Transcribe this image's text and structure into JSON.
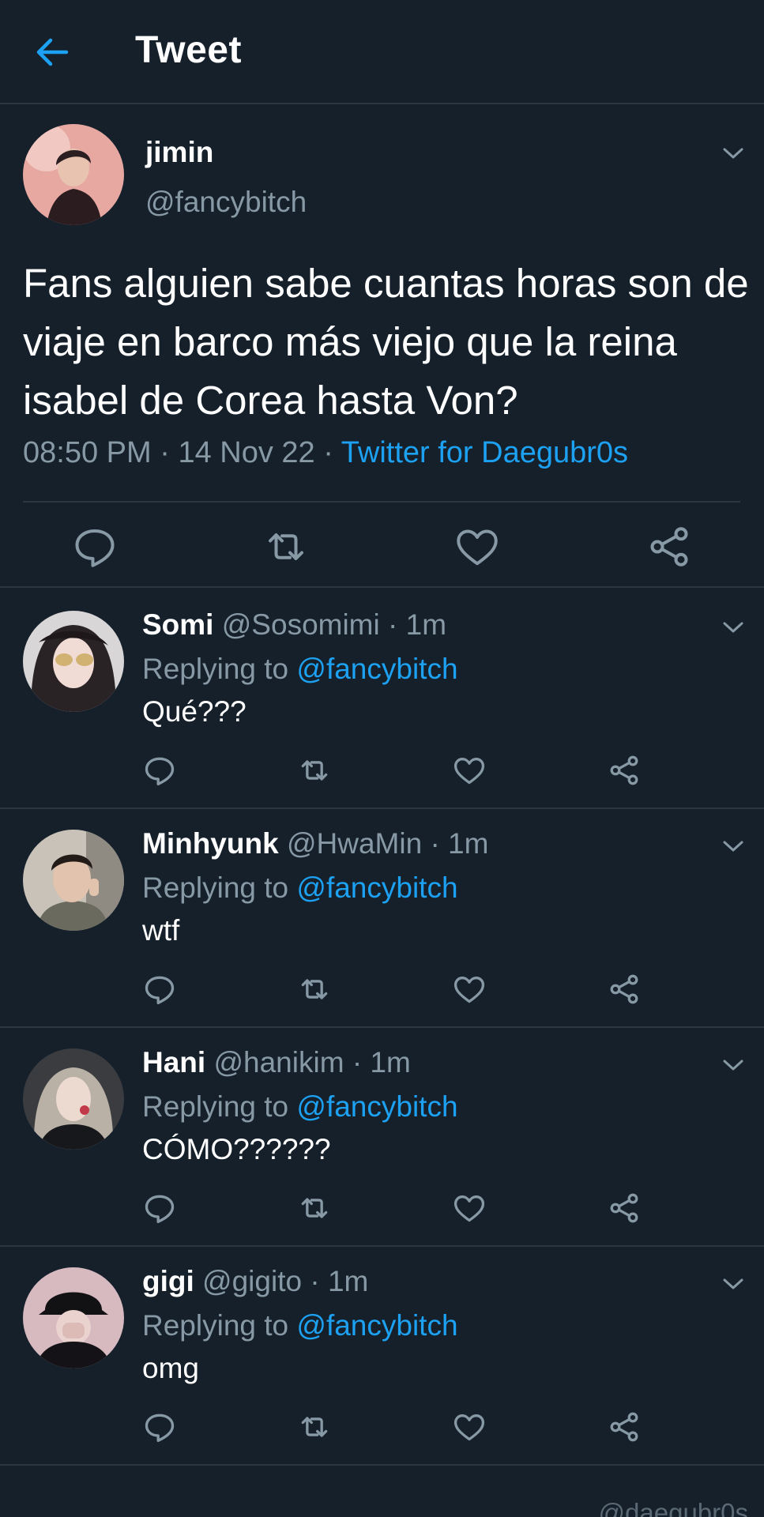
{
  "header": {
    "title": "Tweet",
    "back_icon": "arrow-left-icon"
  },
  "main_tweet": {
    "name": "jimin",
    "handle": "@fancybitch",
    "text": "Fans alguien sabe cuantas horas son de viaje en barco más viejo que la reina isabel de Corea hasta Von?",
    "time": "08:50 PM",
    "date": "14 Nov 22",
    "separator": " · ",
    "source": "Twitter for Daegubr0s",
    "actions": [
      "reply-icon",
      "retweet-icon",
      "like-icon",
      "share-icon"
    ]
  },
  "replies": [
    {
      "name": "Somi",
      "handle": "@Sosomimi",
      "time": "1m",
      "replying_label": "Replying to",
      "mention": "@fancybitch",
      "text": "Qué???"
    },
    {
      "name": "Minhyunk",
      "handle": "@HwaMin",
      "time": "1m",
      "replying_label": "Replying to",
      "mention": "@fancybitch",
      "text": "wtf"
    },
    {
      "name": "Hani",
      "handle": "@hanikim",
      "time": "1m",
      "replying_label": "Replying to",
      "mention": "@fancybitch",
      "text": "CÓMO??????"
    },
    {
      "name": "gigi",
      "handle": "@gigito",
      "time": "1m",
      "replying_label": "Replying to",
      "mention": "@fancybitch",
      "text": "omg"
    }
  ],
  "watermark": "@daegubr0s",
  "colors": {
    "background": "#15202b",
    "accent": "#1da1f2",
    "secondary_text": "#8899a6",
    "divider": "#2b3642"
  }
}
